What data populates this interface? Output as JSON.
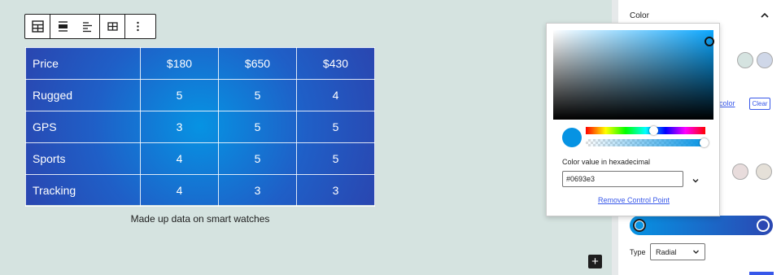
{
  "toolbar": {
    "icons": [
      "table-icon",
      "align-wide-icon",
      "align-text-icon",
      "table-edit-icon",
      "more-options-icon"
    ]
  },
  "table": {
    "rows": [
      [
        "Price",
        "$180",
        "$650",
        "$430"
      ],
      [
        "Rugged",
        "5",
        "5",
        "4"
      ],
      [
        "GPS",
        "3",
        "5",
        "5"
      ],
      [
        "Sports",
        "4",
        "5",
        "5"
      ],
      [
        "Tracking",
        "4",
        "3",
        "3"
      ]
    ],
    "caption": "Made up data on smart watches"
  },
  "inserter": {
    "label": "+"
  },
  "sidebar": {
    "color_heading": "Color",
    "custom_color_link": "color",
    "clear_label": "Clear",
    "gradient": {
      "start": "#0693e3",
      "end": "#2b47b2"
    },
    "type_label": "Type",
    "type_value": "Radial",
    "swatch_colors_row1": [
      "#d5e3e0",
      "#cfd7e8"
    ],
    "swatch_colors_row2": [
      "#e8dcdc",
      "#e5e0d8"
    ]
  },
  "picker": {
    "hex_label": "Color value in hexadecimal",
    "hex_value": "#0693e3",
    "remove_link": "Remove Control Point",
    "current_color": "#0693e3"
  },
  "colors": {
    "canvas_bg": "#d5e3e0",
    "accent": "#3858e9"
  }
}
